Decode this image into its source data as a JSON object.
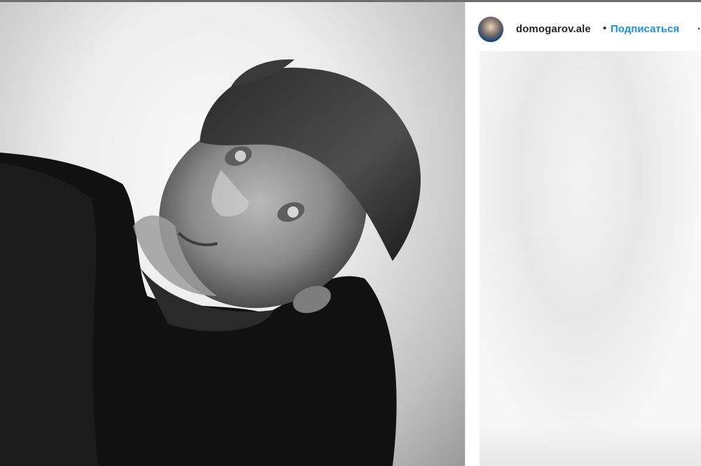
{
  "post_header": {
    "username": "domogarov.ale",
    "separator": "•",
    "follow_label": "Подписаться",
    "more_glyph": "·"
  },
  "icons": {
    "avatar": "profile-avatar",
    "more": "ellipsis-icon"
  },
  "colors": {
    "follow_link": "#1a93e6",
    "username": "#262626",
    "panel_border": "#dbdbdb"
  },
  "photo": {
    "kind": "black-and-white portrait"
  }
}
